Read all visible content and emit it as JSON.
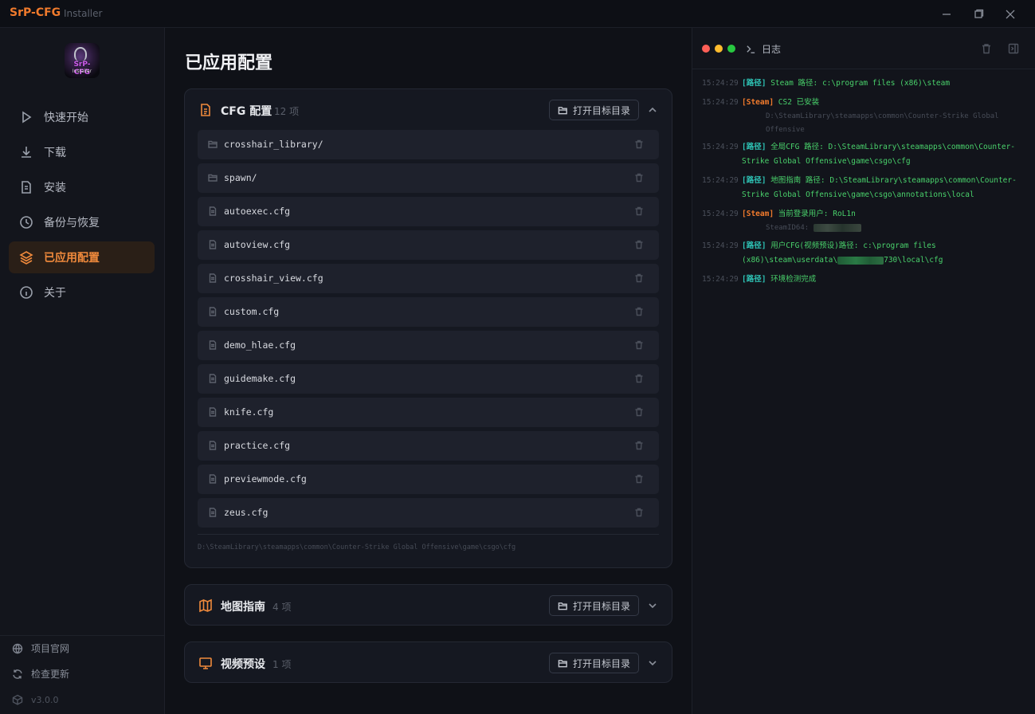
{
  "titlebar": {
    "app_name": "SrP-CFG",
    "app_sub": "Installer"
  },
  "sidebar": {
    "logo_text": "SrP-CFG",
    "logo_sub": "Installer",
    "items": [
      {
        "label": "快速开始",
        "icon": "play-icon"
      },
      {
        "label": "下载",
        "icon": "download-icon"
      },
      {
        "label": "安装",
        "icon": "document-icon"
      },
      {
        "label": "备份与恢复",
        "icon": "clock-icon"
      },
      {
        "label": "已应用配置",
        "icon": "layers-icon",
        "active": true
      },
      {
        "label": "关于",
        "icon": "info-icon"
      }
    ],
    "bottom": {
      "website": "项目官网",
      "update": "检查更新",
      "version": "v3.0.0"
    }
  },
  "main": {
    "title": "已应用配置",
    "cfg_card": {
      "title": "CFG 配置",
      "count": "12 项",
      "open_label": "打开目标目录",
      "files": [
        {
          "name": "crosshair_library/",
          "type": "folder"
        },
        {
          "name": "spawn/",
          "type": "folder"
        },
        {
          "name": "autoexec.cfg",
          "type": "file"
        },
        {
          "name": "autoview.cfg",
          "type": "file"
        },
        {
          "name": "crosshair_view.cfg",
          "type": "file"
        },
        {
          "name": "custom.cfg",
          "type": "file"
        },
        {
          "name": "demo_hlae.cfg",
          "type": "file"
        },
        {
          "name": "guidemake.cfg",
          "type": "file"
        },
        {
          "name": "knife.cfg",
          "type": "file"
        },
        {
          "name": "practice.cfg",
          "type": "file"
        },
        {
          "name": "previewmode.cfg",
          "type": "file"
        },
        {
          "name": "zeus.cfg",
          "type": "file"
        }
      ],
      "path": "D:\\SteamLibrary\\steamapps\\common\\Counter-Strike Global Offensive\\game\\csgo\\cfg"
    },
    "map_card": {
      "title": "地图指南",
      "count": "4 项",
      "open_label": "打开目标目录"
    },
    "video_card": {
      "title": "视频预设",
      "count": "1 项",
      "open_label": "打开目标目录"
    }
  },
  "log": {
    "title": "日志",
    "entries": [
      {
        "time": "15:24:29",
        "tag": "[路径]",
        "tag_type": "path",
        "msg": "Steam 路径: c:\\program files (x86)\\steam"
      },
      {
        "time": "15:24:29",
        "tag": "[Steam]",
        "tag_type": "steam",
        "msg": "CS2 已安装",
        "sub": "D:\\SteamLibrary\\steamapps\\common\\Counter-Strike Global Offensive"
      },
      {
        "time": "15:24:29",
        "tag": "[路径]",
        "tag_type": "path",
        "msg": "全局CFG 路径: D:\\SteamLibrary\\steamapps\\common\\Counter-Strike Global Offensive\\game\\csgo\\cfg"
      },
      {
        "time": "15:24:29",
        "tag": "[路径]",
        "tag_type": "path",
        "msg": "地图指南 路径: D:\\SteamLibrary\\steamapps\\common\\Counter-Strike Global Offensive\\game\\csgo\\annotations\\local"
      },
      {
        "time": "15:24:29",
        "tag": "[Steam]",
        "tag_type": "steam",
        "msg": "当前登录用户: RoL1n",
        "sub": "SteamID64:"
      },
      {
        "time": "15:24:29",
        "tag": "[路径]",
        "tag_type": "path",
        "msg_a": "用户CFG(视频预设)路径: c:\\program files (x86)\\steam\\userdata\\",
        "msg_b": "730\\local\\cfg"
      },
      {
        "time": "15:24:29",
        "tag": "[路径]",
        "tag_type": "path",
        "msg": "环境检测完成"
      }
    ]
  },
  "colors": {
    "accent": "#f07a2c",
    "tag_path": "#2ec4b6",
    "log_msg": "#49d16b"
  }
}
